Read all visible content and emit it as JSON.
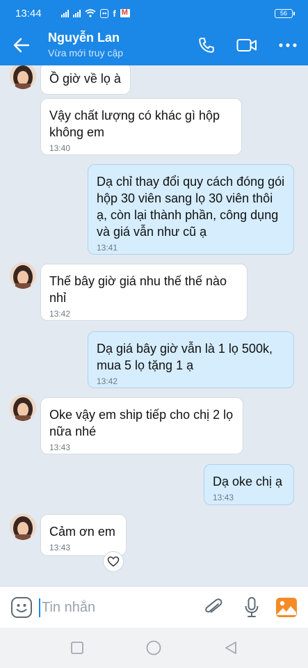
{
  "status_bar": {
    "time": "13:44",
    "battery": "56"
  },
  "header": {
    "contact_name": "Nguyễn Lan",
    "contact_status": "Vừa mới truy cập"
  },
  "messages": [
    {
      "direction": "in",
      "text": "Ồ giờ về lọ à",
      "time": ""
    },
    {
      "direction": "in",
      "text": "Vậy chất lượng có khác gì hộp không em",
      "time": "13:40"
    },
    {
      "direction": "out",
      "text": "Dạ chỉ thay đổi quy cách đóng gói hộp 30 viên sang lọ 30 viên thôi ạ, còn lại thành phần, công dụng và giá vẫn như cũ ạ",
      "time": "13:41"
    },
    {
      "direction": "in",
      "text": "Thế bây giờ giá nhu thế thế nào nhỉ",
      "time": "13:42"
    },
    {
      "direction": "out",
      "text": "Dạ giá bây giờ vẫn là 1 lọ 500k, mua 5 lọ tặng 1 ạ",
      "time": "13:42"
    },
    {
      "direction": "in",
      "text": "Oke vậy em ship tiếp cho chị 2 lọ nữa nhé",
      "time": "13:43"
    },
    {
      "direction": "out",
      "text": "Dạ oke chị ạ",
      "time": "13:43"
    },
    {
      "direction": "in",
      "text": "Cảm ơn em",
      "time": "13:43"
    }
  ],
  "input": {
    "placeholder": "Tin nhắn"
  },
  "icons": {
    "back": "back-arrow-icon",
    "call": "phone-icon",
    "video": "video-camera-icon",
    "more": "more-dots-icon",
    "emoji": "emoji-icon",
    "attach": "paperclip-icon",
    "mic": "microphone-icon",
    "image": "image-icon",
    "reaction": "heart-icon",
    "nav_recent": "square-icon",
    "nav_home": "circle-icon",
    "nav_back": "triangle-back-icon"
  },
  "colors": {
    "brand": "#1b87e6",
    "chat_background": "#e2e9f1",
    "outgoing_bubble": "#d5edfd",
    "incoming_bubble": "#ffffff"
  }
}
